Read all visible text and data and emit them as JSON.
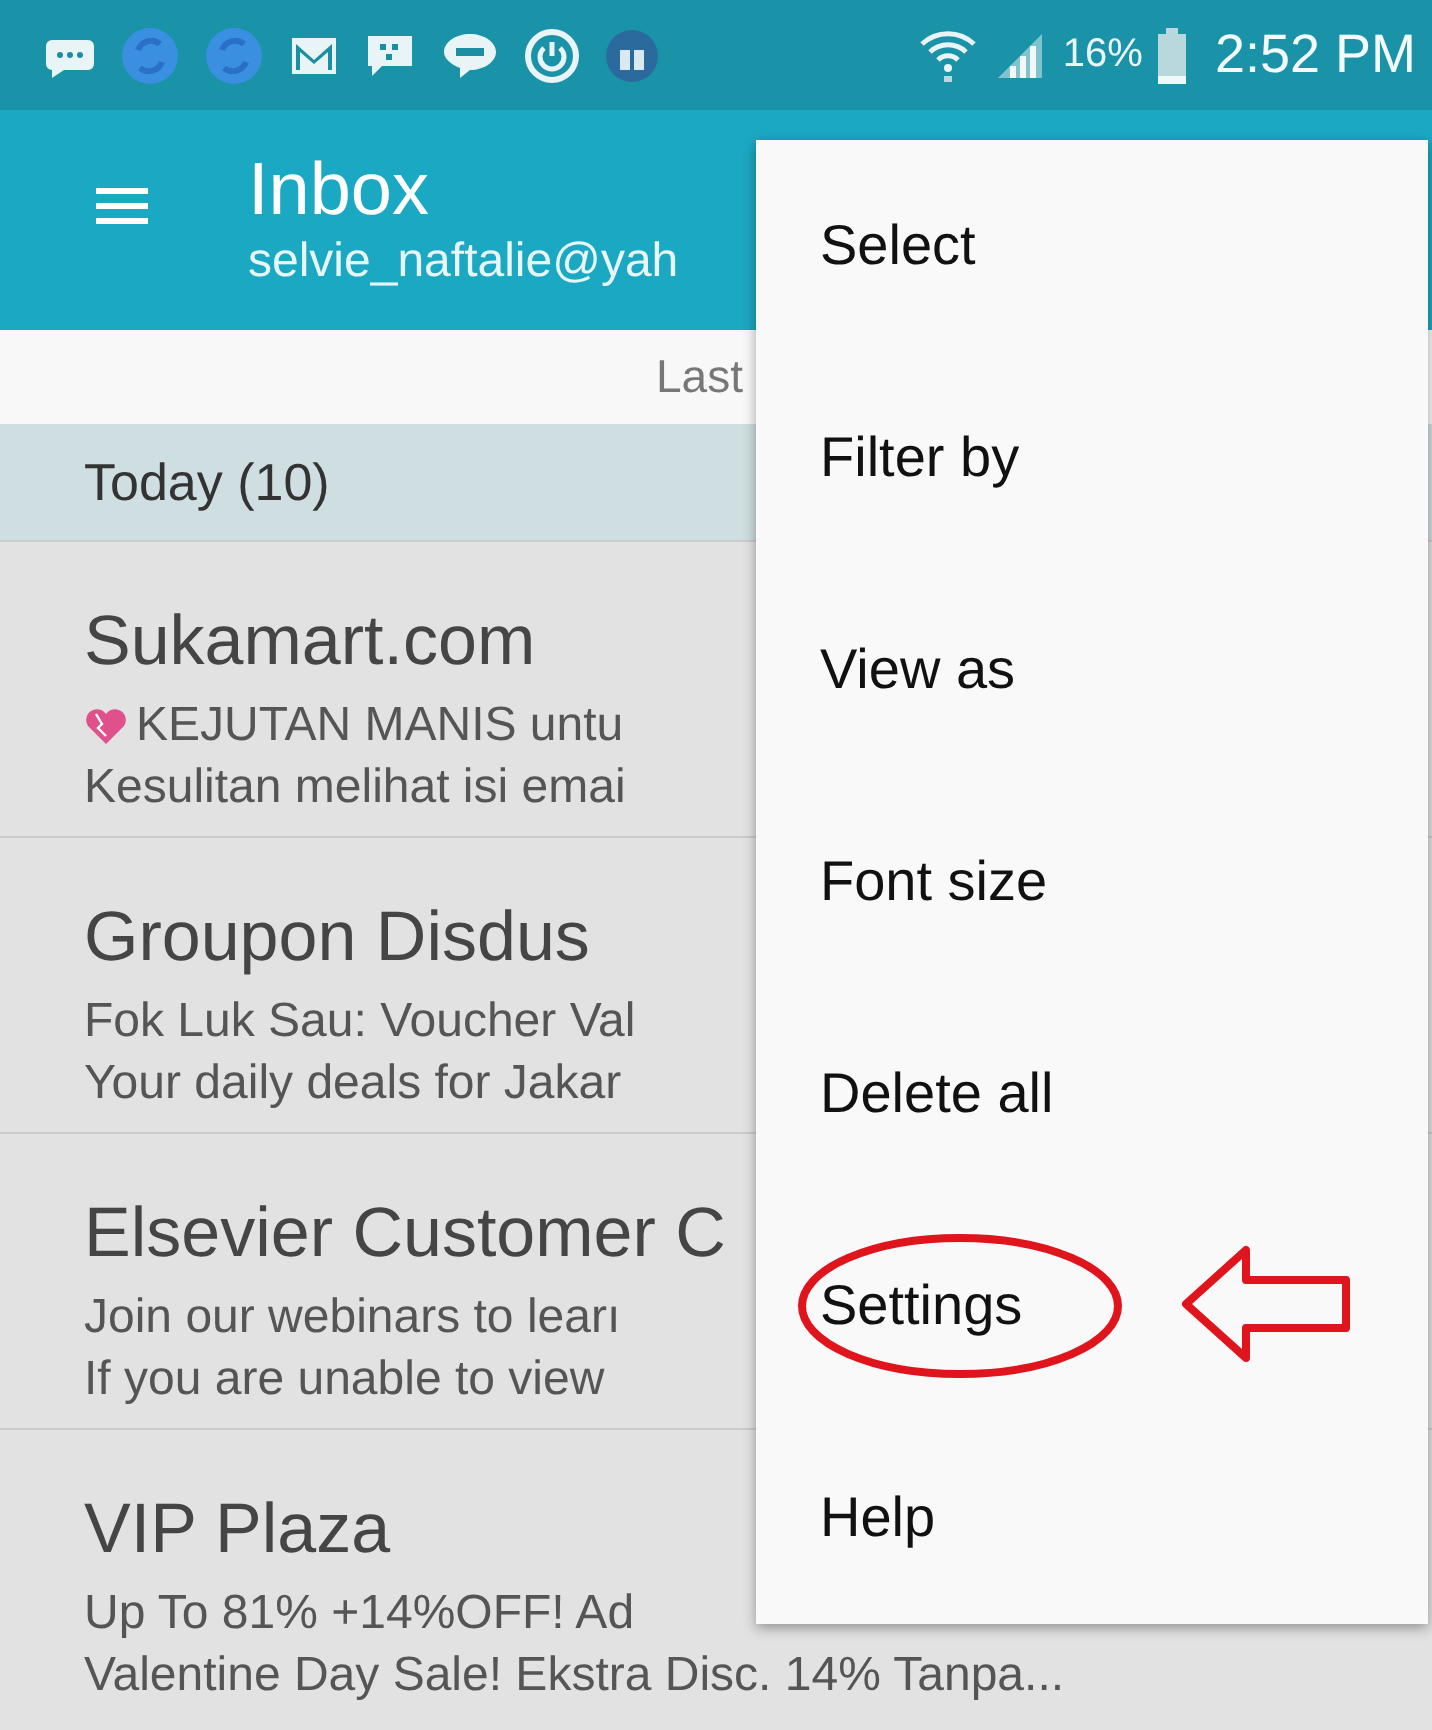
{
  "status_bar": {
    "battery": "16%",
    "time": "2:52 PM"
  },
  "header": {
    "title": "Inbox",
    "account": "selvie_naftalie@yah"
  },
  "sync_bar": {
    "text": "Last"
  },
  "group": {
    "label": "Today (10)"
  },
  "emails": [
    {
      "sender": "Sukamart.com",
      "subject": "KEJUTAN MANIS untu",
      "preview": "Kesulitan melihat isi emai",
      "heart": true
    },
    {
      "sender": "Groupon Disdus",
      "subject": "Fok Luk Sau: Voucher Val",
      "preview": "Your daily deals for Jakar",
      "heart": false
    },
    {
      "sender": "Elsevier Customer C",
      "subject": "Join our webinars to learı",
      "preview": "If you are unable to view",
      "heart": false
    },
    {
      "sender": "VIP Plaza",
      "subject": "Up To 81% +14%OFF! Ad",
      "preview": "Valentine Day Sale! Ekstra Disc. 14% Tanpa...",
      "heart": false
    }
  ],
  "menu": [
    {
      "label": "Select",
      "marked": false
    },
    {
      "label": "Filter by",
      "marked": false
    },
    {
      "label": "View as",
      "marked": false
    },
    {
      "label": "Font size",
      "marked": false
    },
    {
      "label": "Delete all",
      "marked": false
    },
    {
      "label": "Settings",
      "marked": true
    },
    {
      "label": "Help",
      "marked": false
    }
  ]
}
